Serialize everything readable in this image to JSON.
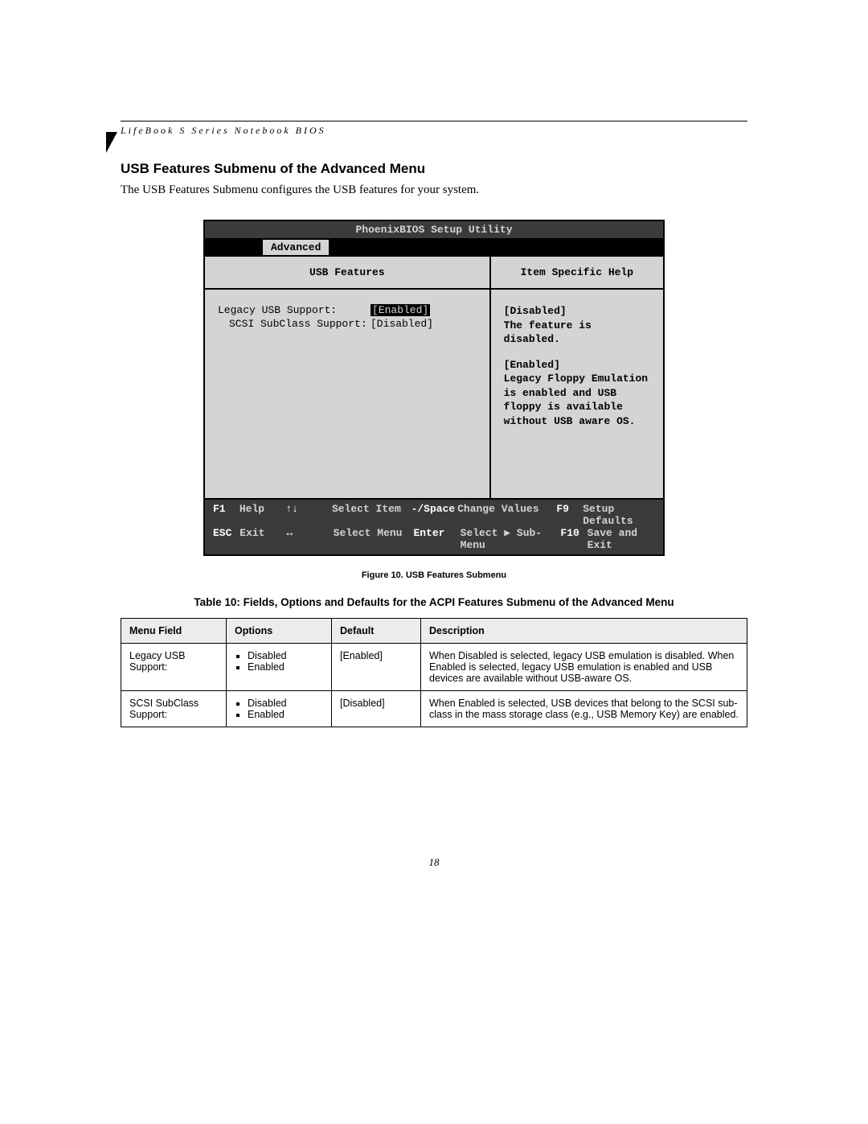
{
  "running_head": "LifeBook S Series Notebook BIOS",
  "section_title": "USB Features Submenu of the Advanced Menu",
  "intro": "The USB Features Submenu configures the USB features for your system.",
  "bios": {
    "title": "PhoenixBIOS Setup Utility",
    "active_tab": "Advanced",
    "left_title": "USB Features",
    "settings": [
      {
        "label": "Legacy USB Support:",
        "value": "[Enabled]",
        "highlight": true
      },
      {
        "label": "SCSI SubClass Support:",
        "value": "[Disabled]",
        "highlight": false
      }
    ],
    "right_title": "Item Specific Help",
    "help_lines": [
      "[Disabled]",
      "The feature is disabled.",
      "",
      "[Enabled]",
      "Legacy Floppy Emulation",
      "is enabled and USB",
      "floppy is available",
      "without USB aware OS."
    ],
    "footer": {
      "r1": {
        "k1": "F1",
        "a1": "Help",
        "k2": "↑↓",
        "a2": "Select Item",
        "k3": "-/Space",
        "a3": "Change Values",
        "k4": "F9",
        "a4": "Setup Defaults"
      },
      "r2": {
        "k1": "ESC",
        "a1": "Exit",
        "k2": "↔",
        "a2": "Select Menu",
        "k3": "Enter",
        "a3": "Select ▶ Sub-Menu",
        "k4": "F10",
        "a4": "Save and Exit"
      }
    }
  },
  "figure_caption": "Figure 10.  USB Features Submenu",
  "table_caption": "Table 10: Fields, Options and Defaults for the ACPI Features Submenu of the Advanced Menu",
  "table": {
    "headers": [
      "Menu Field",
      "Options",
      "Default",
      "Description"
    ],
    "rows": [
      {
        "field": "Legacy USB Support:",
        "options": [
          "Disabled",
          "Enabled"
        ],
        "default": "[Enabled]",
        "description": "When Disabled is selected, legacy USB emulation is disabled. When Enabled is selected, legacy USB emulation is enabled and USB devices are available without USB-aware OS."
      },
      {
        "field": "SCSI SubClass Support:",
        "options": [
          "Disabled",
          "Enabled"
        ],
        "default": "[Disabled]",
        "description": "When Enabled is selected, USB devices that belong to the SCSI sub-class in the mass storage class (e.g., USB Memory Key) are enabled."
      }
    ]
  },
  "page_number": "18"
}
